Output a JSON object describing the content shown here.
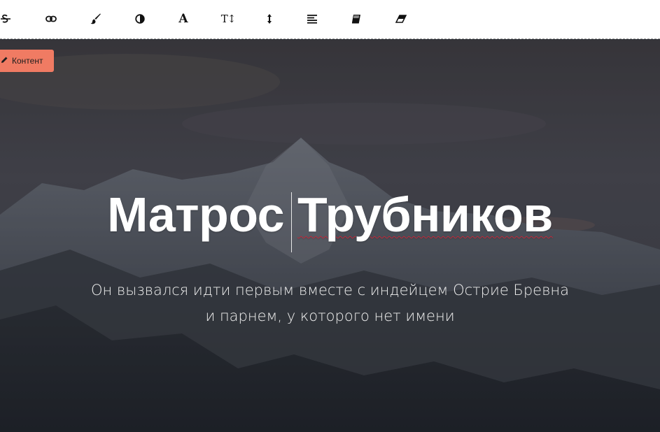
{
  "toolbar": {
    "tools": [
      {
        "name": "strikethrough-icon"
      },
      {
        "name": "link-icon"
      },
      {
        "name": "brush-icon"
      },
      {
        "name": "contrast-icon"
      },
      {
        "name": "font-icon",
        "glyph": "A"
      },
      {
        "name": "text-size-icon",
        "glyph": "T↕"
      },
      {
        "name": "line-height-icon"
      },
      {
        "name": "align-icon"
      },
      {
        "name": "book-icon"
      },
      {
        "name": "eraser-icon"
      }
    ]
  },
  "hero": {
    "badge_label": "Контент",
    "title_word1": "Матрос",
    "title_word2": "Трубников",
    "subtitle_line1": "Он вызвался идти первым вместе с индейцем Острие Бревна",
    "subtitle_line2": "и парнем, у которого нет имени"
  },
  "colors": {
    "badge": "#f07b63",
    "toolbar_bg": "#ffffff",
    "hero_overlay": "#2c2f36",
    "spellcheck_underline": "#c0283a"
  }
}
